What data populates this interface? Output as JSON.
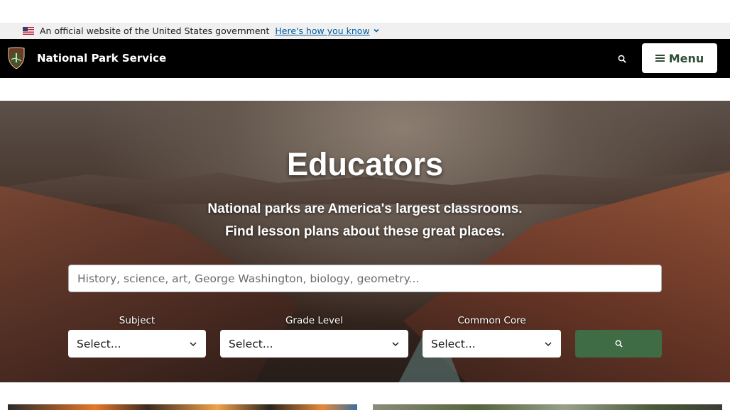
{
  "gov_banner": {
    "text": "An official website of the United States government",
    "link": "Here's how you know"
  },
  "header": {
    "site_name": "National Park Service",
    "menu_label": "Menu"
  },
  "hero": {
    "title": "Educators",
    "subtitle_line1": "National parks are America's largest classrooms.",
    "subtitle_line2": "Find lesson plans about these great places."
  },
  "search": {
    "placeholder": "History, science, art, George Washington, biology, geometry..."
  },
  "filters": {
    "subject": {
      "label": "Subject",
      "value": "Select..."
    },
    "grade": {
      "label": "Grade Level",
      "value": "Select..."
    },
    "common_core": {
      "label": "Common Core",
      "value": "Select..."
    }
  },
  "colors": {
    "header_bg": "#000000",
    "accent_green": "#3f6b45",
    "link_blue": "#005ea2"
  }
}
